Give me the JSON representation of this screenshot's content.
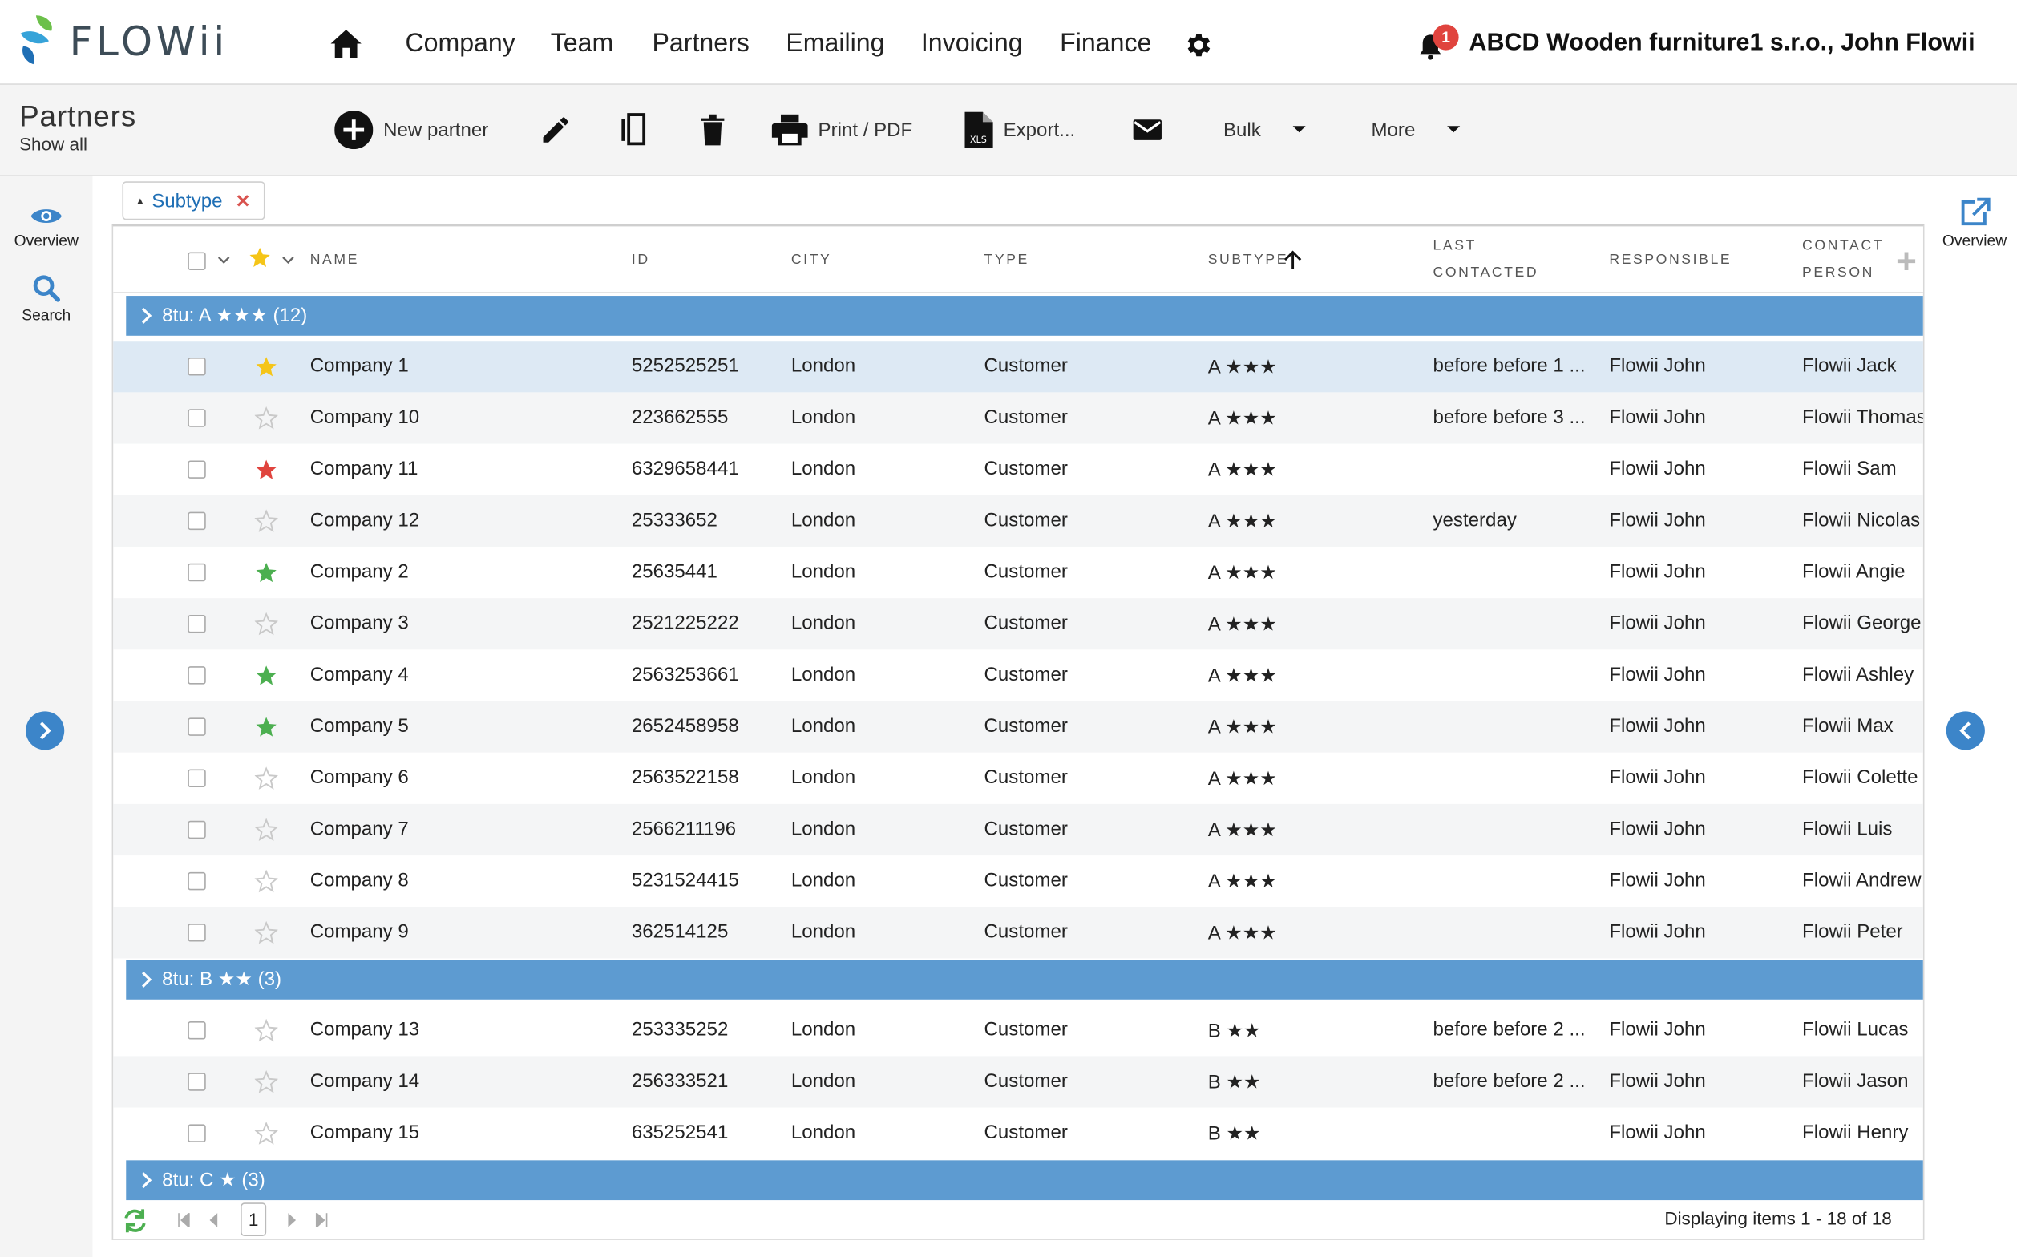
{
  "app": {
    "logo_text": "FLOWii"
  },
  "nav": {
    "items": [
      "Company",
      "Team",
      "Partners",
      "Emailing",
      "Invoicing",
      "Finance"
    ]
  },
  "header": {
    "notification_count": "1",
    "account": "ABCD Wooden furniture1 s.r.o., John Flowii"
  },
  "page": {
    "title": "Partners",
    "subtitle": "Show all"
  },
  "toolbar": {
    "new_partner": "New partner",
    "print": "Print / PDF",
    "export": "Export...",
    "bulk": "Bulk",
    "more": "More"
  },
  "sidebar": {
    "overview": "Overview",
    "search": "Search"
  },
  "right_panel": {
    "overview": "Overview"
  },
  "filter_chip": {
    "label": "Subtype"
  },
  "columns": {
    "name": "NAME",
    "id": "ID",
    "city": "CITY",
    "type": "TYPE",
    "subtype": "SUBTYPE",
    "last_contacted_1": "LAST",
    "last_contacted_2": "CONTACTED",
    "responsible": "RESPONSIBLE",
    "contact_person_1": "CONTACT",
    "contact_person_2": "PERSON"
  },
  "colors": {
    "accent": "#5d9bd1",
    "star_yellow": "#f5c518",
    "star_red": "#e0443e",
    "star_green": "#4caf50",
    "brand_blue": "#3c85c9"
  },
  "groups": [
    {
      "label": "8tu: A ★★★ (12)",
      "rows": [
        {
          "name": "Company 1",
          "id": "5252525251",
          "city": "London",
          "type": "Customer",
          "subtype": "A ★★★",
          "last": "before before 1 ...",
          "responsible": "Flowii John",
          "contact": "Flowii Jack",
          "star": "yellow"
        },
        {
          "name": "Company 10",
          "id": "223662555",
          "city": "London",
          "type": "Customer",
          "subtype": "A ★★★",
          "last": "before before 3 ...",
          "responsible": "Flowii John",
          "contact": "Flowii Thomas",
          "star": "none"
        },
        {
          "name": "Company 11",
          "id": "6329658441",
          "city": "London",
          "type": "Customer",
          "subtype": "A ★★★",
          "last": "",
          "responsible": "Flowii John",
          "contact": "Flowii Sam",
          "star": "red"
        },
        {
          "name": "Company 12",
          "id": "25333652",
          "city": "London",
          "type": "Customer",
          "subtype": "A ★★★",
          "last": "yesterday",
          "responsible": "Flowii John",
          "contact": "Flowii Nicolas",
          "star": "none"
        },
        {
          "name": "Company 2",
          "id": "25635441",
          "city": "London",
          "type": "Customer",
          "subtype": "A ★★★",
          "last": "",
          "responsible": "Flowii John",
          "contact": "Flowii Angie",
          "star": "green"
        },
        {
          "name": "Company 3",
          "id": "2521225222",
          "city": "London",
          "type": "Customer",
          "subtype": "A ★★★",
          "last": "",
          "responsible": "Flowii John",
          "contact": "Flowii George",
          "star": "none"
        },
        {
          "name": "Company 4",
          "id": "2563253661",
          "city": "London",
          "type": "Customer",
          "subtype": "A ★★★",
          "last": "",
          "responsible": "Flowii John",
          "contact": "Flowii Ashley",
          "star": "green"
        },
        {
          "name": "Company 5",
          "id": "2652458958",
          "city": "London",
          "type": "Customer",
          "subtype": "A ★★★",
          "last": "",
          "responsible": "Flowii John",
          "contact": "Flowii Max",
          "star": "green"
        },
        {
          "name": "Company 6",
          "id": "2563522158",
          "city": "London",
          "type": "Customer",
          "subtype": "A ★★★",
          "last": "",
          "responsible": "Flowii John",
          "contact": "Flowii Colette",
          "star": "none"
        },
        {
          "name": "Company 7",
          "id": "2566211196",
          "city": "London",
          "type": "Customer",
          "subtype": "A ★★★",
          "last": "",
          "responsible": "Flowii John",
          "contact": "Flowii Luis",
          "star": "none"
        },
        {
          "name": "Company 8",
          "id": "5231524415",
          "city": "London",
          "type": "Customer",
          "subtype": "A ★★★",
          "last": "",
          "responsible": "Flowii John",
          "contact": "Flowii Andrew",
          "star": "none"
        },
        {
          "name": "Company 9",
          "id": "362514125",
          "city": "London",
          "type": "Customer",
          "subtype": "A ★★★",
          "last": "",
          "responsible": "Flowii John",
          "contact": "Flowii Peter",
          "star": "none"
        }
      ]
    },
    {
      "label": "8tu: B ★★ (3)",
      "rows": [
        {
          "name": "Company 13",
          "id": "253335252",
          "city": "London",
          "type": "Customer",
          "subtype": "B ★★",
          "last": "before before 2 ...",
          "responsible": "Flowii John",
          "contact": "Flowii Lucas",
          "star": "none"
        },
        {
          "name": "Company 14",
          "id": "256333521",
          "city": "London",
          "type": "Customer",
          "subtype": "B ★★",
          "last": "before before 2 ...",
          "responsible": "Flowii John",
          "contact": "Flowii Jason",
          "star": "none"
        },
        {
          "name": "Company 15",
          "id": "635252541",
          "city": "London",
          "type": "Customer",
          "subtype": "B ★★",
          "last": "",
          "responsible": "Flowii John",
          "contact": "Flowii Henry",
          "star": "none"
        }
      ]
    },
    {
      "label": "8tu: C ★ (3)",
      "rows": []
    }
  ],
  "pagination": {
    "page": "1",
    "display": "Displaying items 1 - 18 of 18"
  }
}
